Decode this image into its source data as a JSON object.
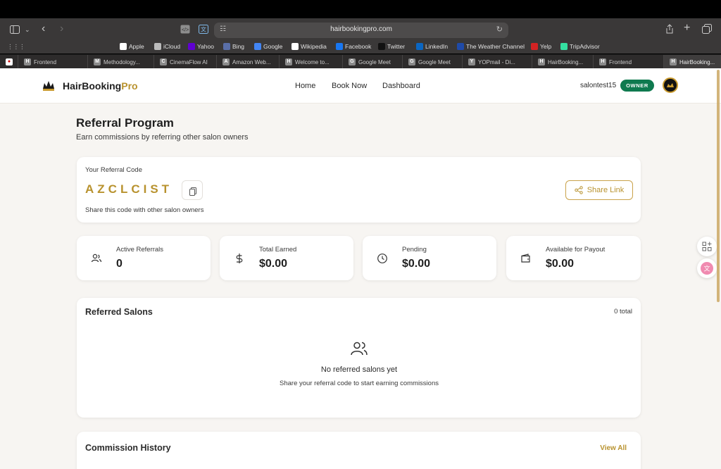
{
  "browser": {
    "url": "hairbookingpro.com",
    "bookmarks": [
      {
        "label": "Apple",
        "icon": "apple-icon",
        "color": "#ffffff"
      },
      {
        "label": "iCloud",
        "icon": "apple-icon",
        "color": "#bbbbbb"
      },
      {
        "label": "Yahoo",
        "icon": "yahoo-icon",
        "color": "#6001d2"
      },
      {
        "label": "Bing",
        "icon": "search-icon",
        "color": "#5a6fa8"
      },
      {
        "label": "Google",
        "icon": "google-icon",
        "color": "#4285f4"
      },
      {
        "label": "Wikipedia",
        "icon": "wikipedia-icon",
        "color": "#ffffff"
      },
      {
        "label": "Facebook",
        "icon": "facebook-icon",
        "color": "#1877f2"
      },
      {
        "label": "Twitter",
        "icon": "x-icon",
        "color": "#111111"
      },
      {
        "label": "LinkedIn",
        "icon": "linkedin-icon",
        "color": "#0a66c2"
      },
      {
        "label": "The Weather Channel",
        "icon": "weather-icon",
        "color": "#1f4aa8"
      },
      {
        "label": "Yelp",
        "icon": "yelp-icon",
        "color": "#d32323"
      },
      {
        "label": "TripAdvisor",
        "icon": "tripadvisor-icon",
        "color": "#34e0a1"
      }
    ],
    "tabs": [
      {
        "label": "Frontend",
        "icon": "H"
      },
      {
        "label": "Methodology...",
        "icon": "M"
      },
      {
        "label": "CinemaFlow AI",
        "icon": "C"
      },
      {
        "label": "Amazon Web...",
        "icon": "A"
      },
      {
        "label": "Welcome to...",
        "icon": "H"
      },
      {
        "label": "Google Meet",
        "icon": "G"
      },
      {
        "label": "Google Meet",
        "icon": "G"
      },
      {
        "label": "YOPmail - Di...",
        "icon": "Y"
      },
      {
        "label": "HairBooking...",
        "icon": "H"
      },
      {
        "label": "Frontend",
        "icon": "H"
      },
      {
        "label": "HairBooking...",
        "icon": "H"
      }
    ]
  },
  "navbar": {
    "brand_main": "HairBooking",
    "brand_accent": "Pro",
    "links": [
      "Home",
      "Book Now",
      "Dashboard"
    ],
    "username": "salontest15",
    "role_badge": "OWNER"
  },
  "header": {
    "title": "Referral Program",
    "subtitle": "Earn commissions by referring other salon owners"
  },
  "referral": {
    "label": "Your Referral Code",
    "code": "AZCLCIST",
    "help": "Share this code with other salon owners",
    "share_label": "Share Link"
  },
  "stats": [
    {
      "label": "Active Referrals",
      "value": "0",
      "icon": "users-icon"
    },
    {
      "label": "Total Earned",
      "value": "$0.00",
      "icon": "dollar-icon"
    },
    {
      "label": "Pending",
      "value": "$0.00",
      "icon": "clock-icon"
    },
    {
      "label": "Available for Payout",
      "value": "$0.00",
      "icon": "wallet-icon"
    }
  ],
  "referred_salons": {
    "title": "Referred Salons",
    "total": "0 total",
    "empty_title": "No referred salons yet",
    "empty_help": "Share your referral code to start earning commissions"
  },
  "commission_history": {
    "title": "Commission History",
    "view_all": "View All"
  },
  "colors": {
    "accent": "#b8922e",
    "owner_badge": "#0f7a4f",
    "page_bg": "#f7f5f2"
  }
}
